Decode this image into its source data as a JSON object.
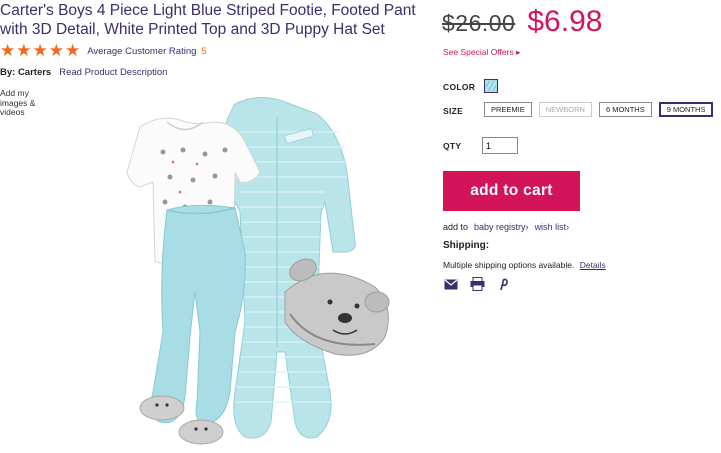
{
  "product": {
    "title": "Carter's Boys 4 Piece Light Blue Striped Footie, Footed Pant with 3D Detail, White Printed Top and 3D Puppy Hat Set",
    "rating_stars": 5,
    "rating_label": "Average Customer Rating",
    "rating_count": "5",
    "brand": "By: Carters",
    "read_description": "Read Product Description",
    "add_media": "Add my images & videos"
  },
  "pricing": {
    "old_price": "$26.00",
    "new_price": "$6.98",
    "special_offers": "See Special Offers ▸"
  },
  "options": {
    "color_label": "COLOR",
    "size_label": "SIZE",
    "sizes": [
      {
        "label": "PREEMIE",
        "state": "available"
      },
      {
        "label": "NEWBORN",
        "state": "disabled"
      },
      {
        "label": "6 MONTHS",
        "state": "available"
      },
      {
        "label": "9 MONTHS",
        "state": "selected"
      }
    ],
    "qty_label": "QTY",
    "qty_value": "1"
  },
  "cart": {
    "add_to_cart": "add to cart",
    "add_to_prefix": "add to",
    "baby_registry": "baby registry›",
    "wish_list": "wish list›"
  },
  "shipping": {
    "title": "Shipping:",
    "text": "Multiple shipping options available.",
    "details": "Details"
  },
  "icons": {
    "star": "star-icon",
    "email": "email-icon",
    "print": "print-icon",
    "pinterest": "pinterest-icon"
  },
  "colors": {
    "accent": "#d4145a",
    "brand_purple": "#3b2d6e",
    "star_orange": "#f26b1d",
    "garment_blue": "#a9dde5"
  }
}
